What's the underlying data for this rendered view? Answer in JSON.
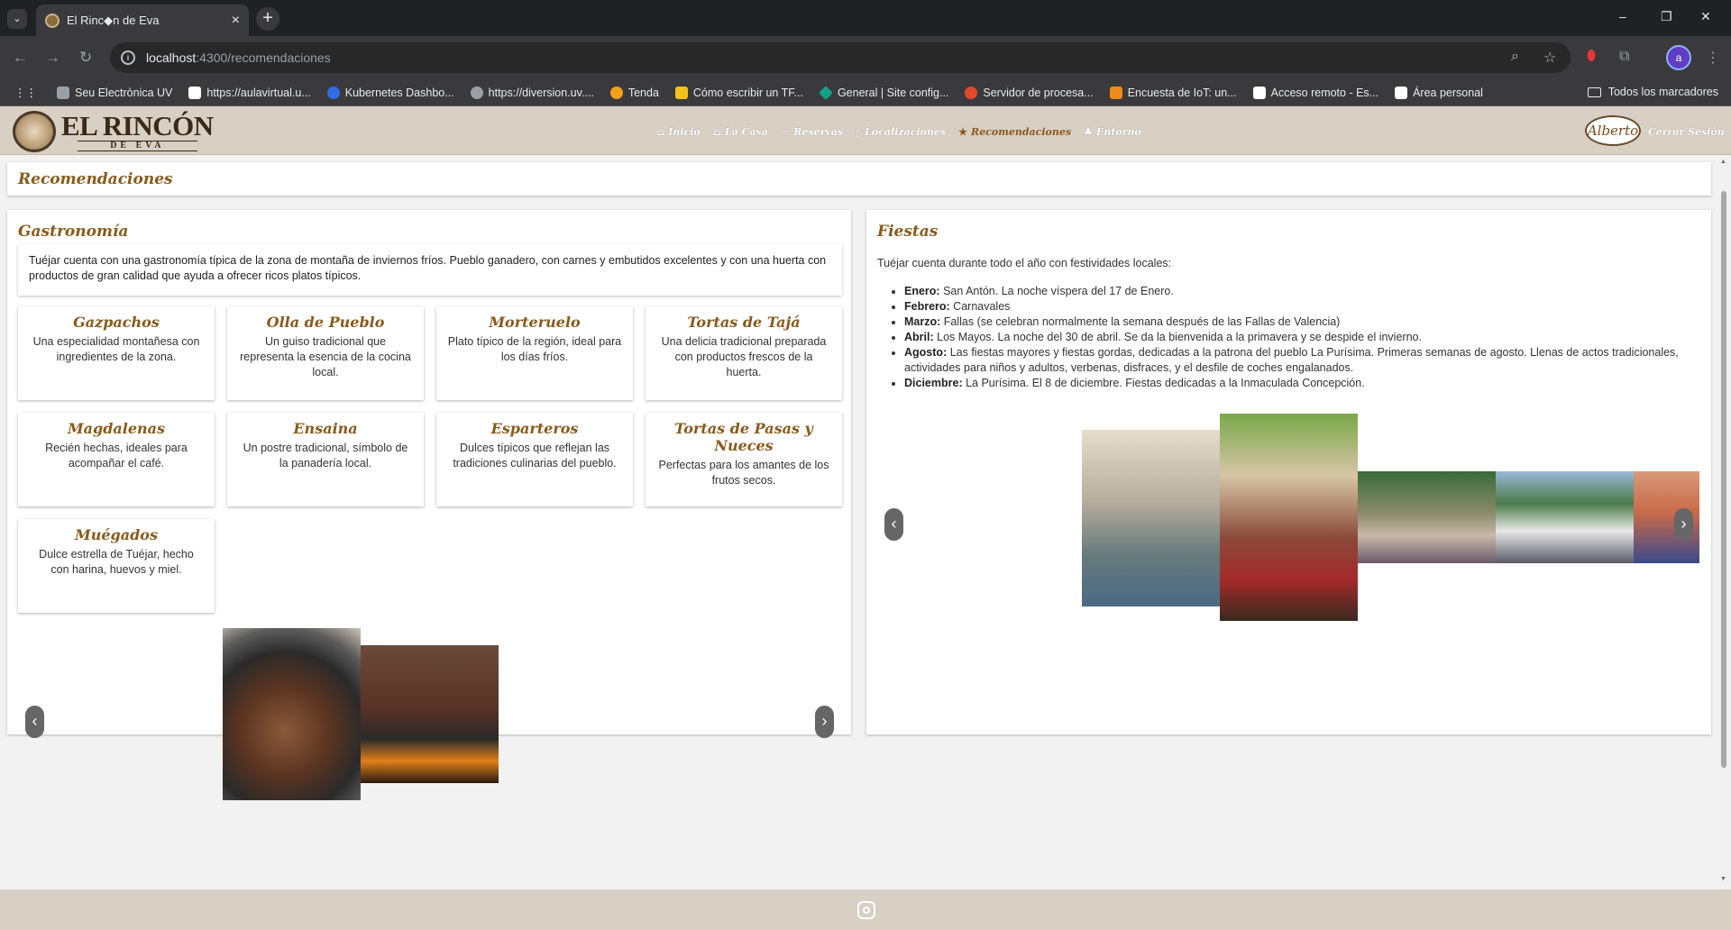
{
  "browser": {
    "tab_title": "El Rinc◆n de Eva",
    "url_host": "localhost",
    "url_path": ":4300/recomendaciones",
    "profile_initial": "a",
    "bookmarks": [
      {
        "label": "Seu Electrònica UV",
        "color": "#9aa0a6"
      },
      {
        "label": "https://aulavirtual.u...",
        "color": "#ffffff"
      },
      {
        "label": "Kubernetes Dashbo...",
        "color": "#326ce5"
      },
      {
        "label": "https://diversion.uv....",
        "color": "#9aa0a6"
      },
      {
        "label": "Tenda",
        "color": "#f4a21c"
      },
      {
        "label": "Cómo escribir un TF...",
        "color": "#f4c21c"
      },
      {
        "label": "General | Site config...",
        "color": "#12a08a"
      },
      {
        "label": "Servidor de procesa...",
        "color": "#e04a2a"
      },
      {
        "label": "Encuesta de IoT: un...",
        "color": "#f08a1c"
      },
      {
        "label": "Acceso remoto - Es...",
        "color": "#ffffff"
      },
      {
        "label": "Área personal",
        "color": "#ffffff"
      }
    ],
    "all_bookmarks": "Todos los marcadores"
  },
  "site": {
    "logo_line1": "EL RINCÓN",
    "logo_line2": "DE EVA",
    "nav": [
      {
        "label": "Inicio",
        "icon": "home-icon",
        "glyph": "⌂"
      },
      {
        "label": "La Casa",
        "icon": "house-icon",
        "glyph": "⌂"
      },
      {
        "label": "Reservas",
        "icon": "calendar-icon",
        "glyph": "▭"
      },
      {
        "label": "Localizaciones",
        "icon": "map-pin-icon",
        "glyph": "▯"
      },
      {
        "label": "Recomendaciones",
        "icon": "star-icon",
        "glyph": "★",
        "active": true
      },
      {
        "label": "Entorno",
        "icon": "tree-icon",
        "glyph": "♣"
      }
    ],
    "user": "Alberto",
    "logout": "Cerrar Sesión",
    "accent": "#8a5a1a",
    "header_bg": "#d8cfc5"
  },
  "page": {
    "title": "Recomendaciones"
  },
  "gastronomia": {
    "heading": "Gastronomía",
    "intro": "Tuéjar cuenta con una gastronomía típica de la zona de montaña de inviernos fríos. Pueblo ganadero, con carnes y embutidos excelentes y con una huerta con productos de gran calidad que ayuda a ofrecer ricos platos típicos.",
    "dishes": [
      {
        "name": "Gazpachos",
        "desc": "Una especialidad montañesa con ingredientes de la zona."
      },
      {
        "name": "Olla de Pueblo",
        "desc": "Un guiso tradicional que representa la esencia de la cocina local."
      },
      {
        "name": "Morteruelo",
        "desc": "Plato típico de la región, ideal para los días fríos."
      },
      {
        "name": "Tortas de Tajá",
        "desc": "Una delicia tradicional preparada con productos frescos de la huerta."
      },
      {
        "name": "Magdalenas",
        "desc": "Recién hechas, ideales para acompañar el café."
      },
      {
        "name": "Ensaina",
        "desc": "Un postre tradicional, símbolo de la panadería local."
      },
      {
        "name": "Esparteros",
        "desc": "Dulces típicos que reflejan las tradiciones culinarias del pueblo."
      },
      {
        "name": "Tortas de Pasas y Nueces",
        "desc": "Perfectas para los amantes de los frutos secos."
      },
      {
        "name": "Muégados",
        "desc": "Dulce estrella de Tuéjar, hecho con harina, huevos y miel."
      }
    ],
    "prev": "‹",
    "next": "›"
  },
  "fiestas": {
    "heading": "Fiestas",
    "intro": "Tuéjar cuenta durante todo el año con festividades locales:",
    "items": [
      {
        "month": "Enero:",
        "text": " San Antón. La noche víspera del 17 de Enero."
      },
      {
        "month": "Febrero:",
        "text": " Carnavales"
      },
      {
        "month": "Marzo:",
        "text": " Fallas (se celebran normalmente la semana después de las Fallas de Valencia)"
      },
      {
        "month": "Abril:",
        "text": " Los Mayos. La noche del 30 de abril. Se da la bienvenida a la primavera y se despide el invierno."
      },
      {
        "month": "Agosto:",
        "text": " Las fiestas mayores y fiestas gordas, dedicadas a la patrona del pueblo La Purísima. Primeras semanas de agosto. Llenas de actos tradicionales, actividades para niños y adultos, verbenas, disfraces, y el desfile de coches engalanados."
      },
      {
        "month": "Diciembre:",
        "text": " La Purísima. El 8 de diciembre. Fiestas dedicadas a la Inmaculada Concepción."
      }
    ],
    "prev": "‹",
    "next": "›"
  }
}
